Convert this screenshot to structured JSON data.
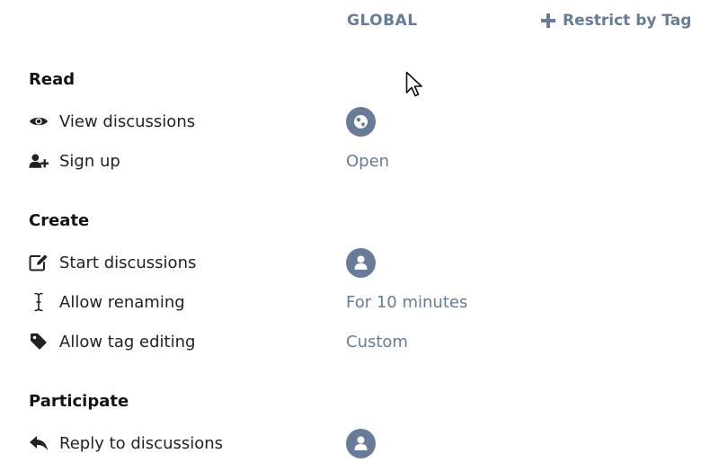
{
  "header": {
    "global_label": "GLOBAL",
    "restrict_label": "Restrict by Tag"
  },
  "sections": [
    {
      "title": "Read",
      "rows": [
        {
          "label": "View discussions",
          "icon": "eye-icon",
          "value_type": "badge",
          "badge_icon": "globe-icon"
        },
        {
          "label": "Sign up",
          "icon": "user-plus-icon",
          "value": "Open"
        }
      ]
    },
    {
      "title": "Create",
      "rows": [
        {
          "label": "Start discussions",
          "icon": "edit-icon",
          "value_type": "badge",
          "badge_icon": "user-icon"
        },
        {
          "label": "Allow renaming",
          "icon": "i-cursor-icon",
          "value": "For 10 minutes"
        },
        {
          "label": "Allow tag editing",
          "icon": "tag-icon",
          "value": "Custom"
        }
      ]
    },
    {
      "title": "Participate",
      "rows": [
        {
          "label": "Reply to discussions",
          "icon": "reply-icon",
          "value_type": "badge",
          "badge_icon": "user-icon"
        }
      ]
    }
  ],
  "colors": {
    "accent": "#667c99",
    "text": "#222222",
    "background": "#ffffff"
  }
}
